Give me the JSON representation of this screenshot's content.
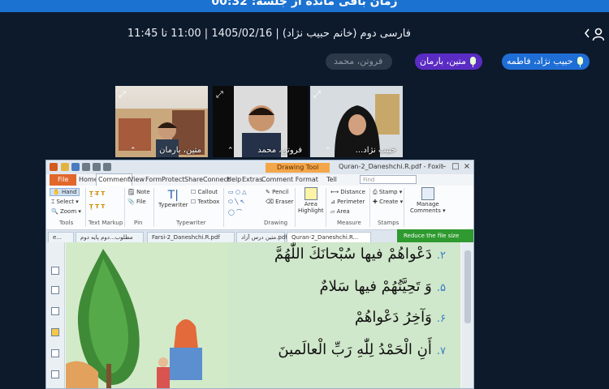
{
  "timer": {
    "text": "زمان باقی مانده از جلسه: 00:32"
  },
  "session": {
    "info": "فارسی دوم (خانم حبیب نژاد) | 1405/02/16 | 11:00 تا 11:45"
  },
  "participants": [
    {
      "name": "حبیب نژاد، فاطمه",
      "color": "#1f6ed6"
    },
    {
      "name": "متین، بارمان",
      "color": "#5a2cc4"
    },
    {
      "name": "فروتن، محمد",
      "color": "#2b3848"
    }
  ],
  "tiles": [
    {
      "label": "متین، بارمان"
    },
    {
      "label": "فروتن، محمد"
    },
    {
      "label": "حبیب نژاد..."
    }
  ],
  "app": {
    "drawing_tool": "Drawing Tool",
    "doc_title": "Quran-2_Daneshchi.R.pdf - Foxit",
    "search_placeholder": "Find",
    "tell": "Tell",
    "menus": [
      "File",
      "Home",
      "Comment",
      "View",
      "Form",
      "Protect",
      "Share",
      "Connect",
      "Help",
      "Extras",
      "Comment Format"
    ],
    "ribbon": {
      "hand": "Hand",
      "select": "Select",
      "zoom": "Zoom",
      "tools_group": "Tools",
      "text_markup": "Text Markup",
      "note": "Note",
      "file": "File",
      "pin_group": "Pin",
      "typewriter": "Typewriter",
      "callout": "Callout",
      "textbox": "Textbox",
      "typewriter_group": "Typewriter",
      "pencil": "Pencil",
      "eraser": "Eraser",
      "drawing_group": "Drawing",
      "area_highlight_1": "Area",
      "area_highlight_2": "Highlight",
      "distance": "Distance",
      "perimeter": "Perimeter",
      "area": "Area",
      "measure_group": "Measure",
      "stamp": "Stamp",
      "create": "Create",
      "stamps_group": "Stamps",
      "manage_1": "Manage",
      "manage_2": "Comments"
    },
    "tabs": [
      "e...",
      "مطلوب...دوم پایه دوم",
      "Farsi-2_Daneshchi.R.pdf",
      "متین درس آزاد.pdf",
      "Quran-2_Daneshchi.R..."
    ],
    "reduce": "Reduce the file size",
    "verses": [
      {
        "num": "۲.",
        "text": "دَعْواهُمْ فيها سُبْحانَكَ اللّٰهُمَّ"
      },
      {
        "num": "۵.",
        "text": "وَ تَحِيَّتُهُمْ فيها سَلامٌ"
      },
      {
        "num": "۶.",
        "text": "وَآخِرُ دَعْواهُمْ"
      },
      {
        "num": "۷.",
        "text": "أَنِ الْحَمْدُ لِلّٰهِ رَبِّ الْعالَمينَ"
      }
    ]
  },
  "colors": {
    "accent": "#1c72d0",
    "background": "#0d1a2b",
    "reduce_green": "#2f9a2f"
  }
}
